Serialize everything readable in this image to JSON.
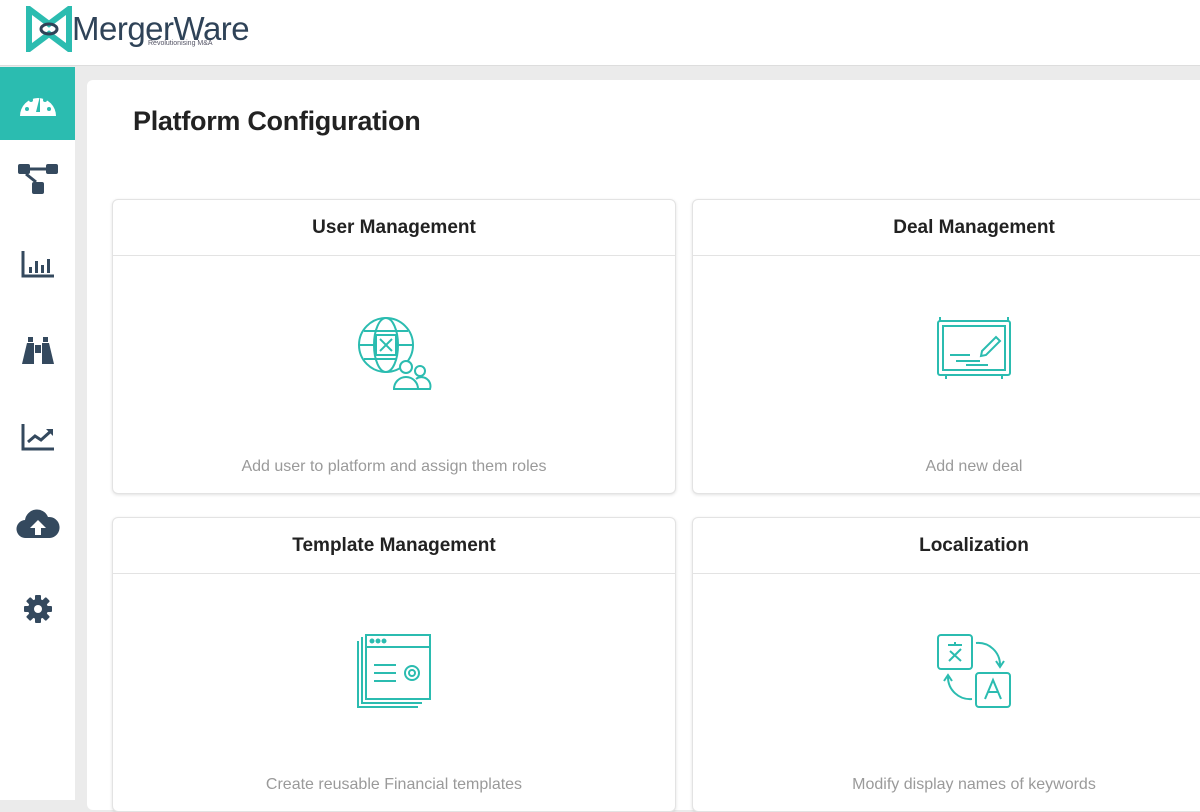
{
  "brand": {
    "name": "MergerWare",
    "tagline": "Revolutionising M&A",
    "accent": "#2bbcb0"
  },
  "sidebar": {
    "items": [
      {
        "icon": "dashboard-icon",
        "active": true
      },
      {
        "icon": "workflow-icon"
      },
      {
        "icon": "bar-chart-icon"
      },
      {
        "icon": "binoculars-icon"
      },
      {
        "icon": "line-chart-icon"
      },
      {
        "icon": "cloud-upload-icon"
      },
      {
        "icon": "gear-icon"
      }
    ]
  },
  "page": {
    "title": "Platform Configuration"
  },
  "cards": [
    {
      "title": "User Management",
      "description": "Add user to platform and assign them roles",
      "icon": "globe-users-icon"
    },
    {
      "title": "Deal Management",
      "description": "Add new deal",
      "icon": "board-pencil-icon"
    },
    {
      "title": "Template Management",
      "description": "Create reusable Financial templates",
      "icon": "template-gear-icon"
    },
    {
      "title": "Localization",
      "description": "Modify display names of keywords",
      "icon": "translate-icon"
    }
  ]
}
